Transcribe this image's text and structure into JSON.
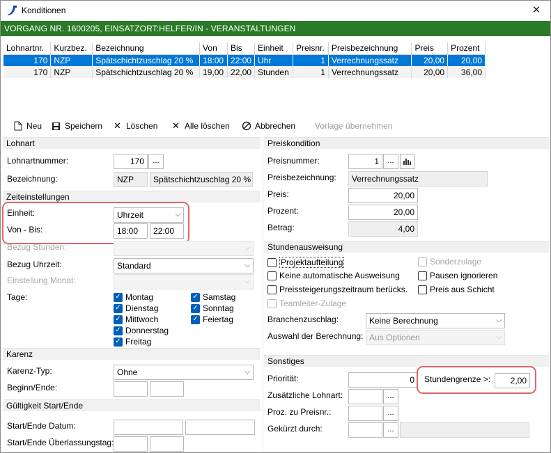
{
  "window": {
    "title": "Konditionen",
    "close_glyph": "✕",
    "banner": "VORGANG NR. 1600205, EINSATZORT:HELFER/IN - VERANSTALTUNGEN"
  },
  "table": {
    "headers": [
      "Lohnartnr.",
      "Kurzbez.",
      "Bezeichnung",
      "Von",
      "Bis",
      "Einheit",
      "Preisnr.",
      "Preisbezeichnung",
      "Preis",
      "Prozent"
    ],
    "rows": [
      [
        "170",
        "NZP",
        "Spätschichtzuschlag 20 %",
        "18:00",
        "22:00",
        "Uhr",
        "1",
        "Verrechnungssatz",
        "20,00",
        "20,00"
      ],
      [
        "170",
        "NZP",
        "Spätschichtzuschlag 20 %",
        "19,00",
        "22,00",
        "Stunden",
        "1",
        "Verrechnungssatz",
        "20,00",
        "36,00"
      ]
    ]
  },
  "toolbar": {
    "neu": "Neu",
    "speichern": "Speichern",
    "loeschen": "Löschen",
    "alle_loeschen": "Alle löschen",
    "abbrechen": "Abbrechen",
    "vorlage": "Vorlage übernehmen"
  },
  "lohnart": {
    "section": "Lohnart",
    "nummer_label": "Lohnartnummer:",
    "nummer_value": "170",
    "bezeichnung_label": "Bezeichnung:",
    "kurz_value": "NZP",
    "bezeichnung_value": "Spätschichtzuschlag 20 %"
  },
  "zeit": {
    "section": "Zeiteinstellungen",
    "einheit_label": "Einheit:",
    "einheit_value": "Uhrzeit",
    "vonbis_label": "Von - Bis:",
    "von_value": "18:00",
    "bis_value": "22:00",
    "bezug_stunden_label": "Bezug Stunden:",
    "bezug_uhrzeit_label": "Bezug Uhrzeit:",
    "bezug_uhrzeit_value": "Standard",
    "einstellung_monat_label": "Einstellung Monat:",
    "tage_label": "Tage:",
    "days_left": [
      "Montag",
      "Dienstag",
      "Mittwoch",
      "Donnerstag",
      "Freitag"
    ],
    "days_right": [
      "Samstag",
      "Sonntag",
      "Feiertag"
    ]
  },
  "karenz": {
    "section": "Karenz",
    "typ_label": "Karenz-Typ:",
    "typ_value": "Ohne",
    "beginn_label": "Beginn/Ende:"
  },
  "gueltigkeit": {
    "section": "Gültigkeit Start/Ende",
    "datum_label": "Start/Ende Datum:",
    "ueberlassung_label": "Start/Ende Überlassungstag:"
  },
  "preis": {
    "section": "Preiskondition",
    "nummer_label": "Preisnummer:",
    "nummer_value": "1",
    "bezeichnung_label": "Preisbezeichnung:",
    "bezeichnung_value": "Verrechnungssatz",
    "preis_label": "Preis:",
    "preis_value": "20,00",
    "prozent_label": "Prozent:",
    "prozent_value": "20,00",
    "betrag_label": "Betrag:",
    "betrag_value": "4,00"
  },
  "stunden": {
    "section": "Stundenausweisung",
    "projektaufteilung": "Projektaufteilung",
    "sonderzulage": "Sonderzulage",
    "keine_auto": "Keine automatische Ausweisung",
    "pausen": "Pausen ignorieren",
    "preissteigerung": "Preissteigerungszeitraum berücks.",
    "preis_schicht": "Preis aus Schicht",
    "teamleiter": "Teamleiter-Zulage",
    "branchen_label": "Branchenzuschlag:",
    "branchen_value": "Keine Berechnung",
    "auswahl_label": "Auswahl der Berechnung:",
    "auswahl_value": "Aus Optionen"
  },
  "sonstiges": {
    "section": "Sonstiges",
    "prioritaet_label": "Priorität:",
    "prioritaet_value": "0",
    "stundengrenze_label": "Stundengrenze >:",
    "stundengrenze_value": "2,00",
    "zusaetzlich_label": "Zusätzliche Lohnart:",
    "proz_label": "Proz. zu Preisnr.:",
    "gekuerzt_label": "Gekürzt durch:"
  },
  "icons": {
    "ellipsis": "...",
    "chevron": "⌵",
    "check": "✓"
  }
}
